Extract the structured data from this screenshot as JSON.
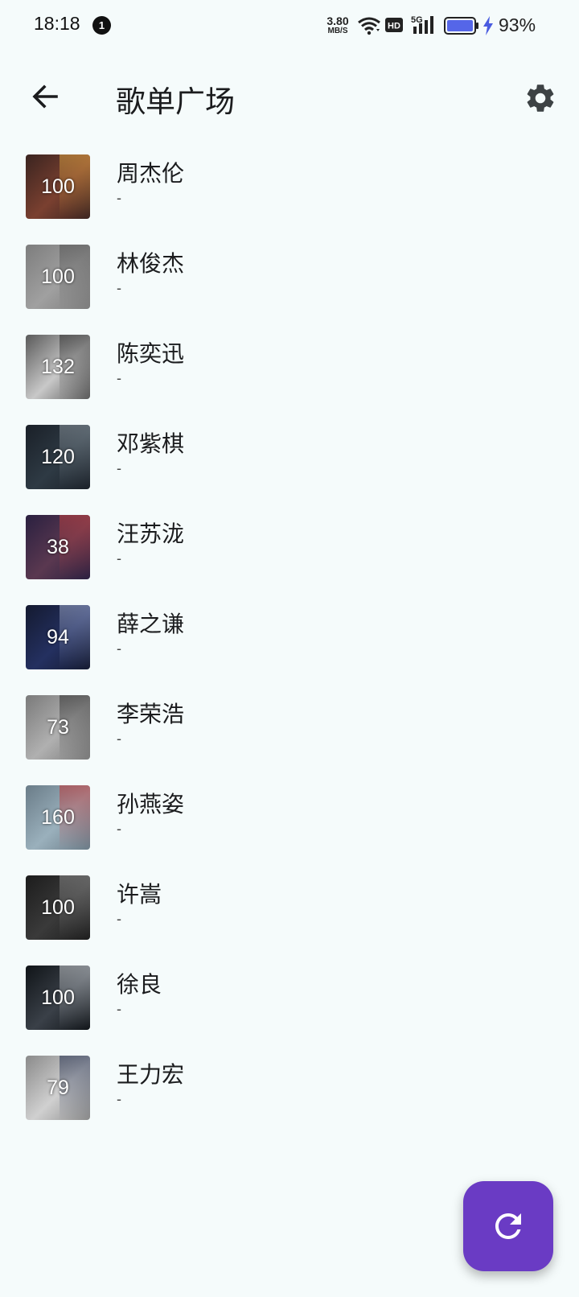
{
  "status_bar": {
    "time": "18:18",
    "notification_count": "1",
    "net_speed_value": "3.80",
    "net_speed_unit": "MB/S",
    "hd_label": "HD",
    "signal_label": "5G",
    "battery_percent": "93%"
  },
  "app_bar": {
    "title": "歌单广场",
    "back_icon": "arrow-back-icon",
    "settings_icon": "gear-icon"
  },
  "playlists": [
    {
      "name": "周杰伦",
      "subtitle": "-",
      "count": "100",
      "cover_colors": [
        "#3a2420",
        "#7a4030",
        "#d9a040"
      ]
    },
    {
      "name": "林俊杰",
      "subtitle": "-",
      "count": "100",
      "cover_colors": [
        "#7d7d7d",
        "#a0a0a0",
        "#505050"
      ]
    },
    {
      "name": "陈奕迅",
      "subtitle": "-",
      "count": "132",
      "cover_colors": [
        "#5a5a5a",
        "#c8c8c8",
        "#2a2a2a"
      ]
    },
    {
      "name": "邓紫棋",
      "subtitle": "-",
      "count": "120",
      "cover_colors": [
        "#1a2028",
        "#2e3a44",
        "#8a949c"
      ]
    },
    {
      "name": "汪苏泷",
      "subtitle": "-",
      "count": "38",
      "cover_colors": [
        "#2a2040",
        "#5a3850",
        "#c04040"
      ]
    },
    {
      "name": "薛之谦",
      "subtitle": "-",
      "count": "94",
      "cover_colors": [
        "#141a30",
        "#243060",
        "#9aa6c8"
      ]
    },
    {
      "name": "李荣浩",
      "subtitle": "-",
      "count": "73",
      "cover_colors": [
        "#7a7a7a",
        "#b0b0b0",
        "#2c2c2c"
      ]
    },
    {
      "name": "孙燕姿",
      "subtitle": "-",
      "count": "160",
      "cover_colors": [
        "#6a7c88",
        "#9ab0bc",
        "#c03030"
      ]
    },
    {
      "name": "许嵩",
      "subtitle": "-",
      "count": "100",
      "cover_colors": [
        "#1c1c1c",
        "#3a3a3a",
        "#8a8a8a"
      ]
    },
    {
      "name": "徐良",
      "subtitle": "-",
      "count": "100",
      "cover_colors": [
        "#101418",
        "#3a4048",
        "#c8ccd0"
      ]
    },
    {
      "name": "王力宏",
      "subtitle": "-",
      "count": "79",
      "cover_colors": [
        "#8a8a8a",
        "#d0d0d0",
        "#1e2a4a"
      ]
    }
  ],
  "fab": {
    "icon": "refresh-icon",
    "color": "#6a3bc4"
  },
  "colors": {
    "background": "#f5fbfb",
    "accent": "#6a3bc4",
    "battery_fill": "#5566e8"
  }
}
